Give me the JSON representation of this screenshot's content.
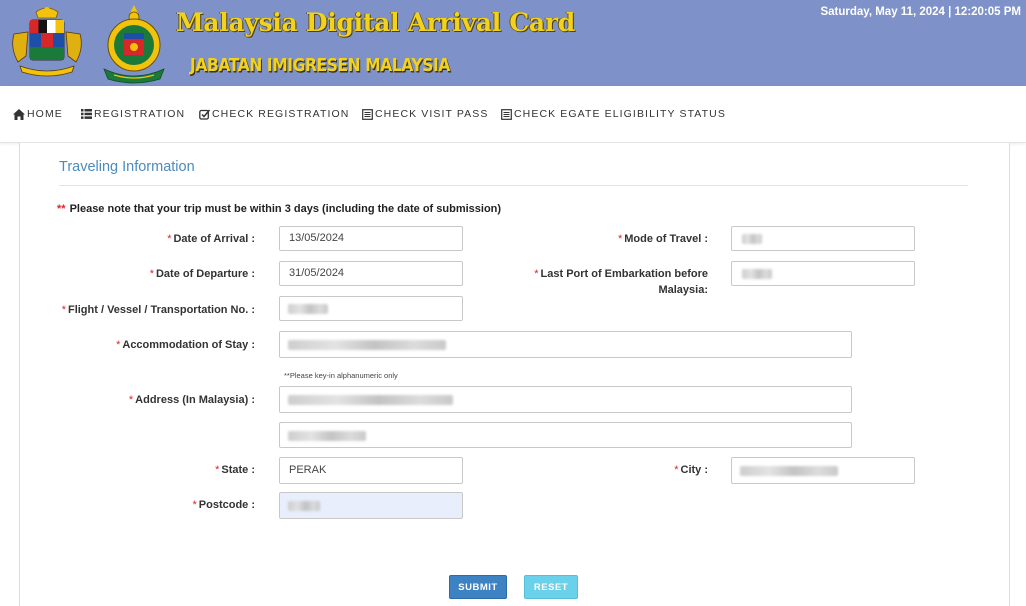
{
  "header": {
    "title": "Malaysia Digital Arrival Card",
    "subtitle": "JABATAN IMIGRESEN MALAYSIA",
    "datetime": "Saturday, May 11, 2024 | 12:20:05 PM",
    "colors": {
      "background": "#7e92c9",
      "title": "#f2d21d"
    }
  },
  "nav": {
    "items": [
      {
        "label": "HOME",
        "icon": "home-icon"
      },
      {
        "label": "REGISTRATION",
        "icon": "list-icon"
      },
      {
        "label": "CHECK REGISTRATION",
        "icon": "check-square-icon"
      },
      {
        "label": "CHECK VISIT PASS",
        "icon": "document-icon"
      },
      {
        "label": "CHECK EGATE ELIGIBILITY STATUS",
        "icon": "document-icon"
      }
    ]
  },
  "form": {
    "section_title": "Traveling Information",
    "note_marker": "**",
    "note": "Please note that your trip must be within 3 days (including the date of submission)",
    "required_marker": "*",
    "fields": {
      "date_of_arrival": {
        "label": "Date of Arrival :",
        "value": "13/05/2024"
      },
      "date_of_departure": {
        "label": "Date of Departure :",
        "value": "31/05/2024"
      },
      "mode_of_travel": {
        "label": "Mode of Travel :"
      },
      "last_port": {
        "label": "Last Port of Embarkation before Malaysia:"
      },
      "flight_no": {
        "label": "Flight / Vessel / Transportation No. :"
      },
      "accommodation": {
        "label": "Accommodation of Stay :",
        "hint": "**Please key-in alphanumeric only"
      },
      "address": {
        "label": "Address (In Malaysia) :"
      },
      "state": {
        "label": "State :",
        "value": "PERAK"
      },
      "city": {
        "label": "City :"
      },
      "postcode": {
        "label": "Postcode :"
      }
    },
    "buttons": {
      "submit": "SUBMIT",
      "reset": "RESET"
    },
    "colors": {
      "section_title": "#4b8bbe",
      "required": "#d9242b",
      "submit": "#3d82c2",
      "reset": "#6bd0e9"
    }
  }
}
